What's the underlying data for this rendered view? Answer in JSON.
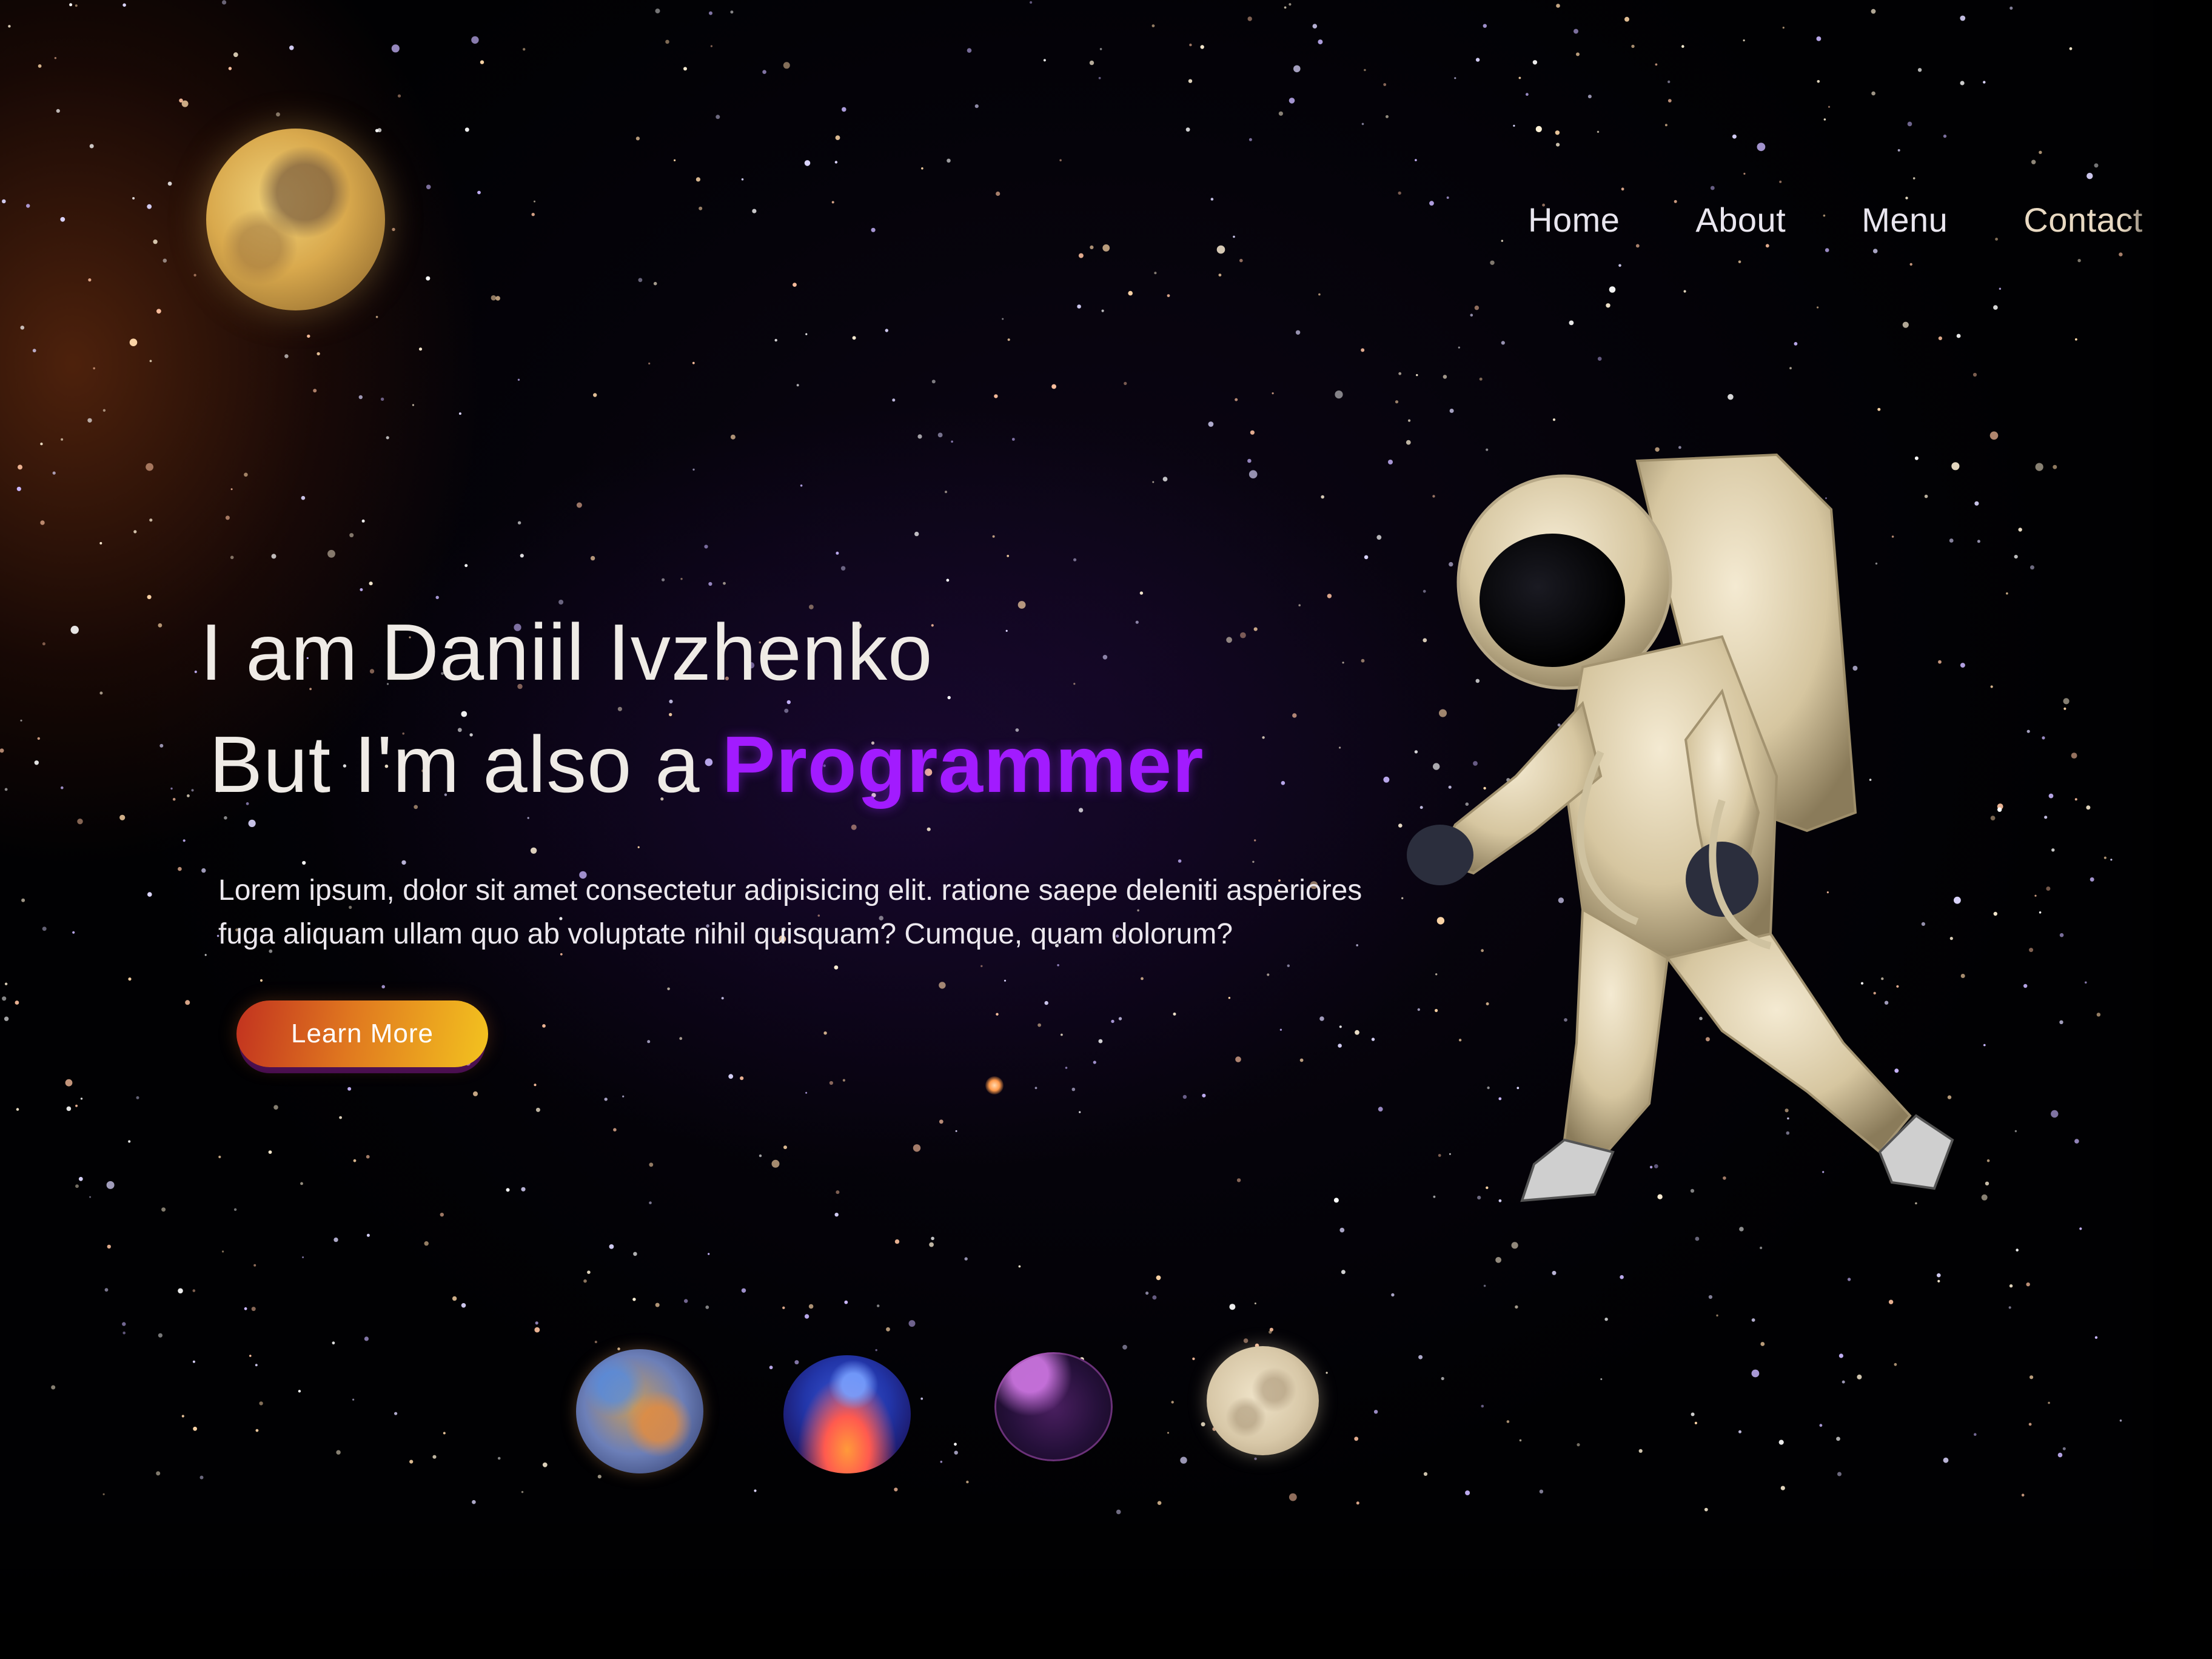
{
  "nav": {
    "items": [
      {
        "label": "Home"
      },
      {
        "label": "About"
      },
      {
        "label": "Menu"
      },
      {
        "label": "Contact"
      }
    ]
  },
  "hero": {
    "line1": "I am Daniil Ivzhenko",
    "line2_prefix": "But I'm also a",
    "line2_highlight": "Programmer",
    "description": "Lorem ipsum, dolor sit amet consectetur adipisicing elit. ratione saepe deleniti asperiores fuga aliquam ullam quo ab voluptate nihil quisquam? Cumque, quam dolorum?",
    "button_label": "Learn More"
  },
  "colors": {
    "highlight": "#a21bff",
    "button_gradient_start": "#c2321f",
    "button_gradient_end": "#f3c31f",
    "background": "#020105"
  },
  "icons": {
    "moon_top": "moon-icon",
    "planets": [
      "planet-mercury-icon",
      "planet-blue-orange-icon",
      "planet-purple-icon",
      "planet-moon-icon"
    ],
    "astronaut": "astronaut-image"
  }
}
